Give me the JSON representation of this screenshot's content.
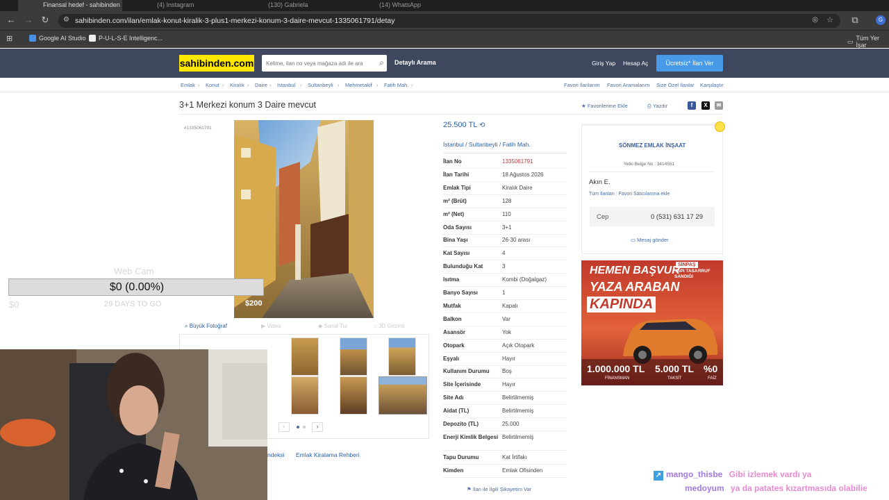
{
  "browser": {
    "tabs": [
      "Finansal hedef - sahibinden",
      "(4) Instagram",
      "(130) Gabriela",
      "(14) WhatsApp"
    ],
    "url": "sahibinden.com/ilan/emlak-konut-kiralik-3-plus1-merkezi-konum-3-daire-mevcut-1335061791/detay",
    "bookmarks": [
      "Google AI Studio",
      "P-U-L-S-E Intelligenc..."
    ],
    "bookmarks_right": "Tüm Yer İşar",
    "profile_initial": "G"
  },
  "site": {
    "logo": "sahibinden.com",
    "search_placeholder": "Kelime, ilan no veya mağaza adı ile ara",
    "advanced_search": "Detaylı Arama",
    "login": "Giriş Yap",
    "register": "Hesap Aç",
    "post_ad": "Ücretsiz* İlan Ver"
  },
  "breadcrumbs": [
    "Emlak",
    "Konut",
    "Kiralık",
    "Daire",
    "İstanbul",
    "Sultanbeyli",
    "Mehmetakif",
    "Fatih Mah."
  ],
  "top_links": [
    "Favori İlanlarım",
    "Favori Aramalarım",
    "Size Özel İlanlar",
    "Karşılaştır"
  ],
  "listing": {
    "title": "3+1 Merkezi konum 3 Daire mevcut",
    "favorite": "Favorilerime Ekle",
    "print": "Yazdır",
    "code": "#1335061791",
    "price": "25.500 TL",
    "location": [
      "İstanbul",
      "Sultanbeyli",
      "Fatih Mah."
    ],
    "photo_tabs": [
      "Büyük Fotoğraf",
      "Video",
      "Sanal Tur",
      "3D Gezinti"
    ],
    "details": [
      {
        "k": "İlan No",
        "v": "1335061791",
        "red": true
      },
      {
        "k": "İlan Tarihi",
        "v": "18 Ağustos 2026"
      },
      {
        "k": "Emlak Tipi",
        "v": "Kiralık Daire"
      },
      {
        "k": "m² (Brüt)",
        "v": "128"
      },
      {
        "k": "m² (Net)",
        "v": "110"
      },
      {
        "k": "Oda Sayısı",
        "v": "3+1"
      },
      {
        "k": "Bina Yaşı",
        "v": "26-30 arası"
      },
      {
        "k": "Kat Sayısı",
        "v": "4"
      },
      {
        "k": "Bulunduğu Kat",
        "v": "3"
      },
      {
        "k": "Isıtma",
        "v": "Kombi (Doğalgaz)"
      },
      {
        "k": "Banyo Sayısı",
        "v": "1"
      },
      {
        "k": "Mutfak",
        "v": "Kapalı"
      },
      {
        "k": "Balkon",
        "v": "Var"
      },
      {
        "k": "Asansör",
        "v": "Yok"
      },
      {
        "k": "Otopark",
        "v": "Açık Otopark"
      },
      {
        "k": "Eşyalı",
        "v": "Hayır"
      },
      {
        "k": "Kullanım Durumu",
        "v": "Boş"
      },
      {
        "k": "Site İçerisinde",
        "v": "Hayır"
      },
      {
        "k": "Site Adı",
        "v": "Belirtilmemiş"
      },
      {
        "k": "Aidat (TL)",
        "v": "Belirtilmemiş"
      },
      {
        "k": "Depozito (TL)",
        "v": "25.000"
      },
      {
        "k": "Enerji Kimlik Belgesi",
        "v": "Belirtilmemiş"
      },
      {
        "k": "Tapu Durumu",
        "v": "Kat İrtifakı"
      },
      {
        "k": "Kimden",
        "v": "Emlak Ofisinden"
      }
    ],
    "bottom_links": [
      "ndeksi",
      "Emlak Kiralama Rehberi"
    ],
    "complaint": "İlan ile İlgili Şikayetim Var"
  },
  "seller": {
    "name": "SÖNMEZ EMLAK İNŞAAT",
    "license": "Yetki Belge No : 3414551",
    "agent": "Akın E.",
    "all_ads": "Tüm İlanları",
    "add_fav": "Favori Satıcılarıma ekle",
    "phone_label": "Cep",
    "phone": "0 (531) 631 17 29",
    "message": "Mesaj gönder"
  },
  "ad": {
    "line1": "HEMEN BAŞVUR",
    "line2": "YAZA ARABAN",
    "line3": "KAPINDA",
    "brand": "SİNPAŞ",
    "brand_sub": "YAPI TASARRUF SANDIĞI",
    "f1": "1.000.000 TL",
    "f1_sub": "FİNANSMAN",
    "f2": "5.000 TL",
    "f2_sub": "TAKSİT",
    "f3": "%0",
    "f3_sub": "FAİZ"
  },
  "overlay": {
    "goal_label": "Web Cam",
    "goal_value": "$0 (0.00%)",
    "goal_progress": 0,
    "goal_min": "$0",
    "goal_days": "29 DAYS TO GO",
    "goal_target": "$200"
  },
  "chat": [
    {
      "user": "mango_thisbe",
      "msg": "Gibi izlemek vardı ya"
    },
    {
      "user": "medoyum",
      "msg": "ya da patates kızartmasıda olabilie"
    }
  ],
  "colors": {
    "brand_yellow": "#ffe800",
    "header": "#3f475f",
    "link": "#2a5fab",
    "post_button": "#489ae9"
  }
}
